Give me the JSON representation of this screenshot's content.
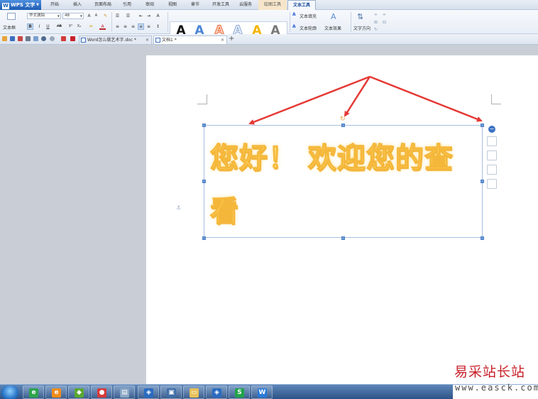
{
  "app": {
    "title": "WPS 文字"
  },
  "menu": {
    "tabs": [
      "开始",
      "插入",
      "页面布局",
      "引用",
      "审阅",
      "视图",
      "章节",
      "开发工具",
      "云服务",
      "绘图工具",
      "文本工具"
    ]
  },
  "ribbon": {
    "textbox_label": "文本框",
    "font_name": "华文琥珀",
    "font_size": "48",
    "style_gallery": [
      "A",
      "A",
      "A",
      "A",
      "A",
      "A"
    ],
    "text_fill": "文本填充",
    "text_outline": "文本轮廓",
    "text_effect": "文本效果",
    "text_direction": "文字方向"
  },
  "doc_tabs": [
    {
      "label": "Word怎么做艺术字.doc *"
    },
    {
      "label": "文档1 *"
    }
  ],
  "document": {
    "art_line1": "您好！ 欢迎您的查",
    "art_line2": "看"
  },
  "watermark": {
    "site_cn": "易采站长站",
    "url": "www.easck.com"
  },
  "colors": {
    "accent": "#1d5cb3",
    "art_fill": "#ffe27a",
    "art_outline": "#f5b73a",
    "arrow": "#e53935"
  }
}
